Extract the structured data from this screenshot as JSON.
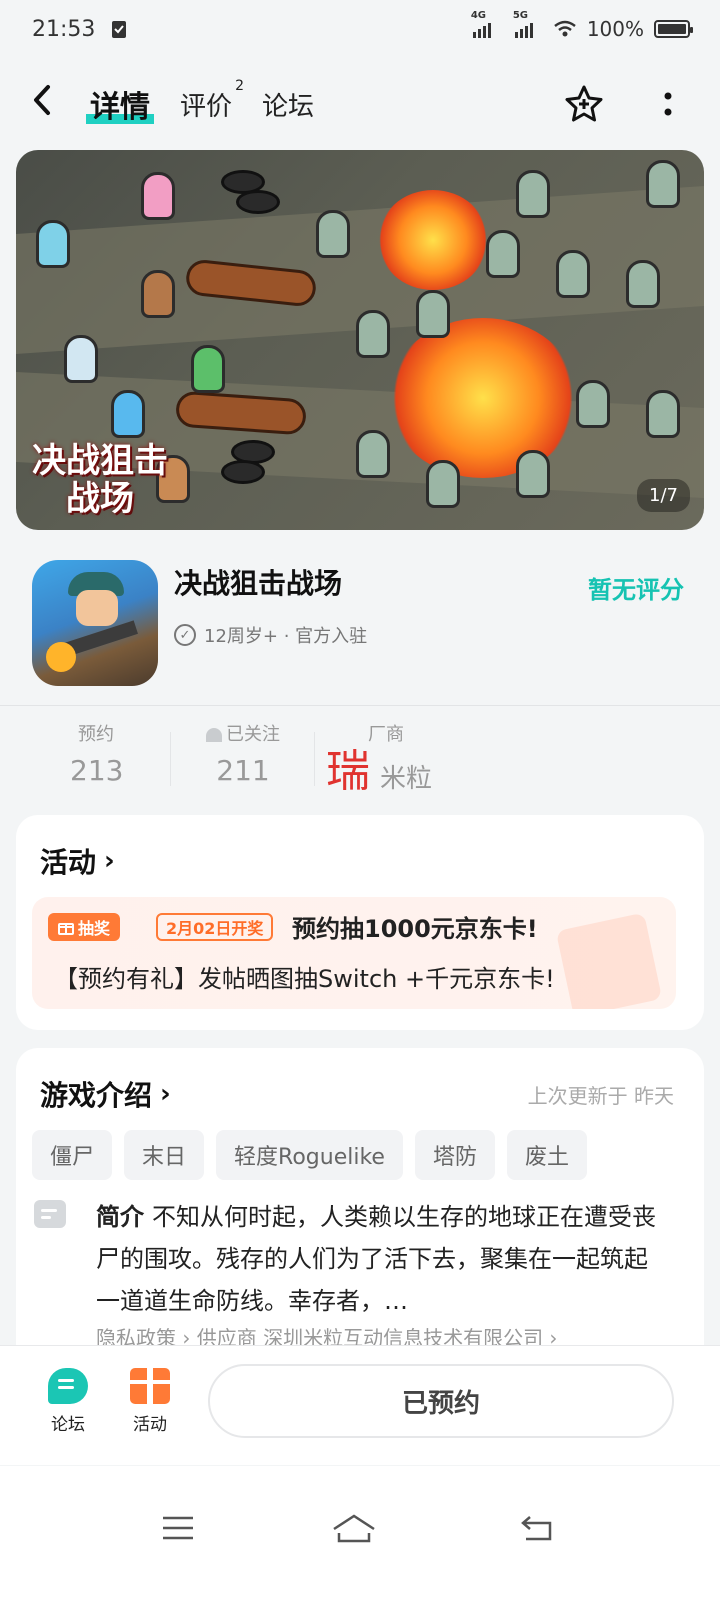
{
  "status_bar": {
    "time": "21:53",
    "network1": "4G",
    "network2": "5G",
    "battery": "100%"
  },
  "header": {
    "tabs": [
      {
        "label": "详情",
        "active": true
      },
      {
        "label": "评价",
        "badge": "2"
      },
      {
        "label": "论坛"
      }
    ]
  },
  "banner": {
    "title_art": "决战狙击战场",
    "page_indicator": "1/7"
  },
  "game": {
    "name": "决战狙击战场",
    "meta": "12周岁+ · 官方入驻",
    "rating": "暂无评分"
  },
  "stats": {
    "reserve_label": "预约",
    "reserve_value": "213",
    "follow_label": "已关注",
    "follow_value": "211",
    "vendor_label": "厂商",
    "vendor_mark": "瑞",
    "vendor_name": "米粒"
  },
  "activity": {
    "title": "活动",
    "badge": "抽奖",
    "date": "2月02日开奖",
    "line1": "预约抽1000元京东卡!",
    "line2": "【预约有礼】发帖晒图抽Switch  +千元京东卡!"
  },
  "intro": {
    "title": "游戏介绍",
    "updated": "上次更新于  昨天",
    "tags": [
      "僵尸",
      "末日",
      "轻度Roguelike",
      "塔防",
      "废土"
    ],
    "summary_label": "简介",
    "summary": "不知从何时起，人类赖以生存的地球正在遭受丧尸的围攻。残存的人们为了活下去，聚集在一起筑起一道道生命防线。幸存者，…",
    "links": "隐私政策 ›   供应商  深圳米粒互动信息技术有限公司 ›"
  },
  "bottom_bar": {
    "forum_label": "论坛",
    "activity_label": "活动",
    "reserved_label": "已预约"
  },
  "colors": {
    "accent": "#1fd0c2",
    "orange": "#ff7a36",
    "vendor_red": "#e0332f"
  }
}
